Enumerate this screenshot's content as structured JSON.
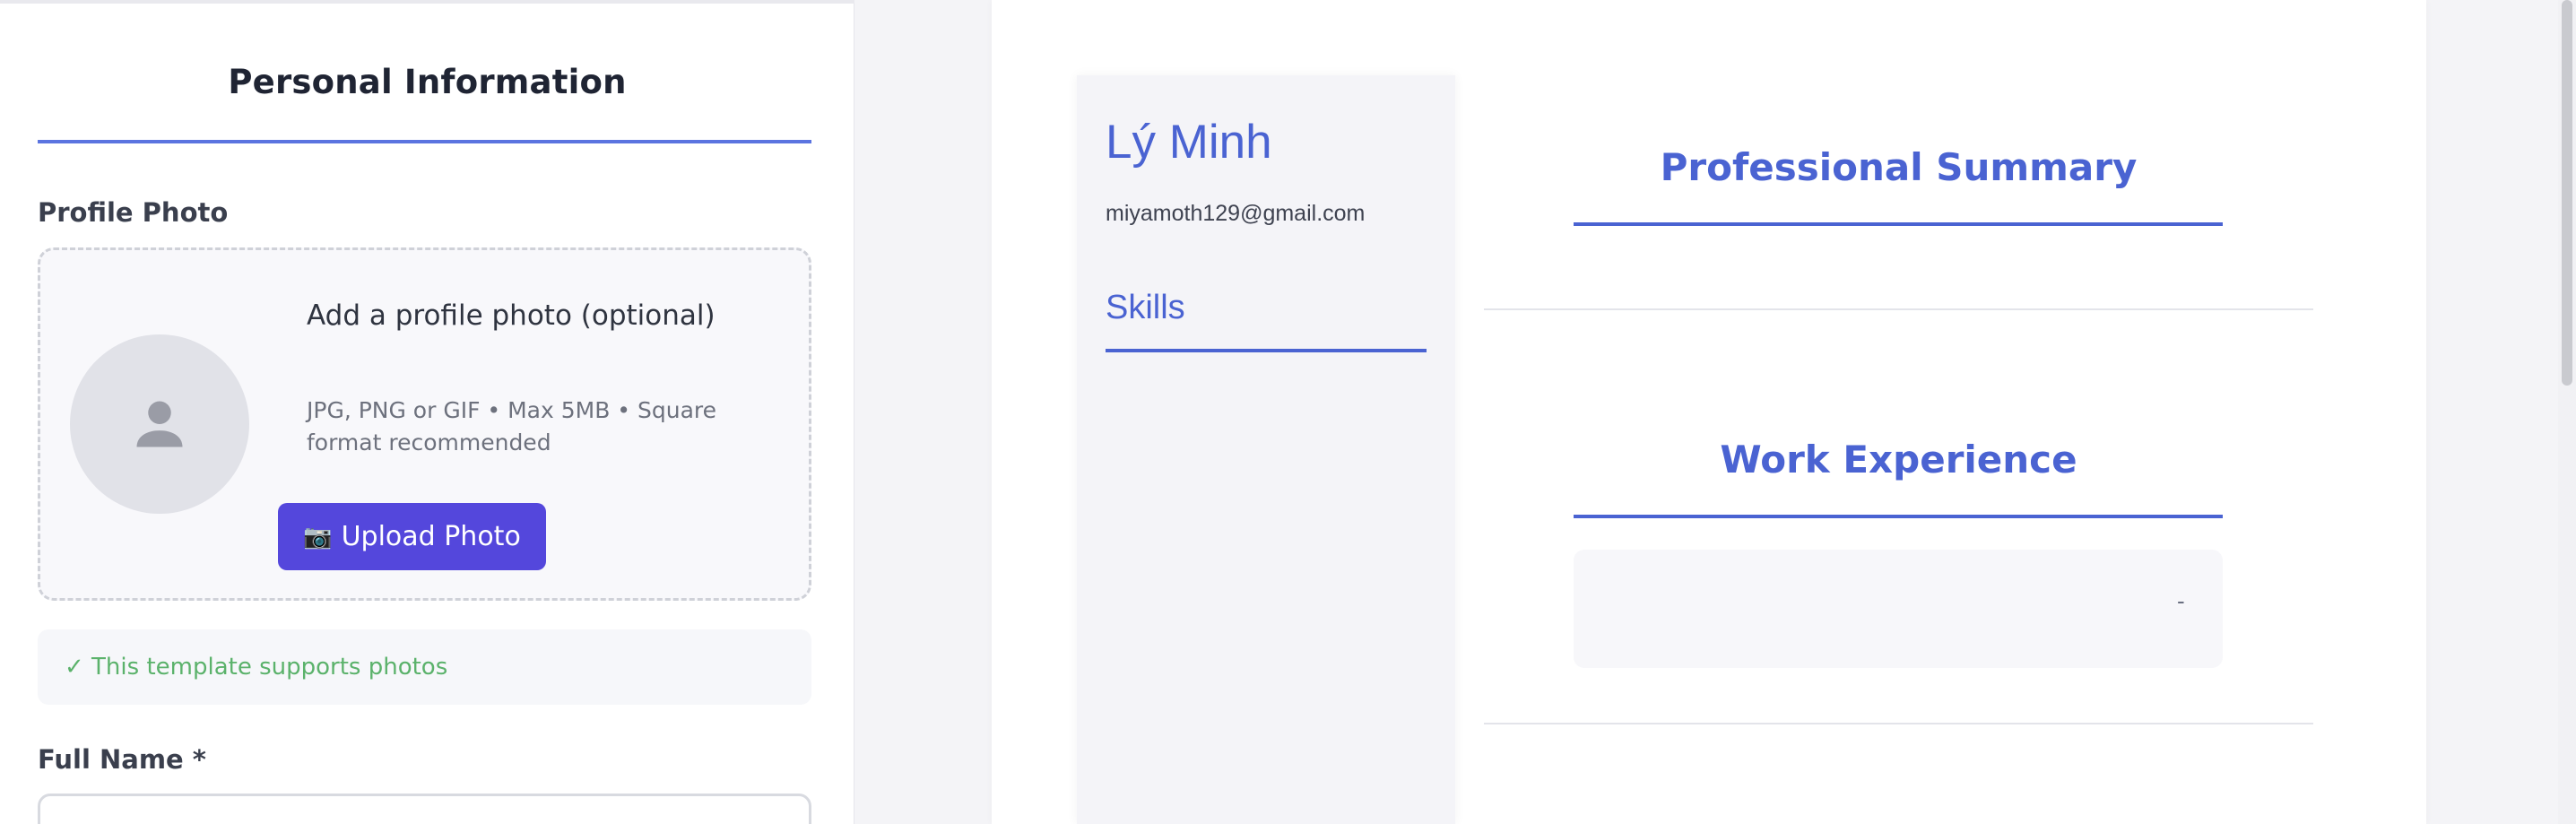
{
  "form": {
    "section_title": "Personal Information",
    "profile_photo_label": "Profile Photo",
    "photo_box_title": "Add a profile photo (optional)",
    "photo_box_hint": "JPG, PNG or GIF • Max 5MB • Square format recommended",
    "upload_button_icon": "📷",
    "upload_button_label": "Upload Photo",
    "notice": "✓ This template supports photos",
    "full_name_label": "Full Name *"
  },
  "preview": {
    "name": "Lý Minh",
    "email": "miyamoth129@gmail.com",
    "skills_heading": "Skills",
    "summary_heading": "Professional Summary",
    "experience_heading": "Work Experience",
    "experience_dash": "-"
  },
  "colors": {
    "accent": "#4a63d2",
    "button": "#5447dc",
    "success": "#5bb26b"
  }
}
